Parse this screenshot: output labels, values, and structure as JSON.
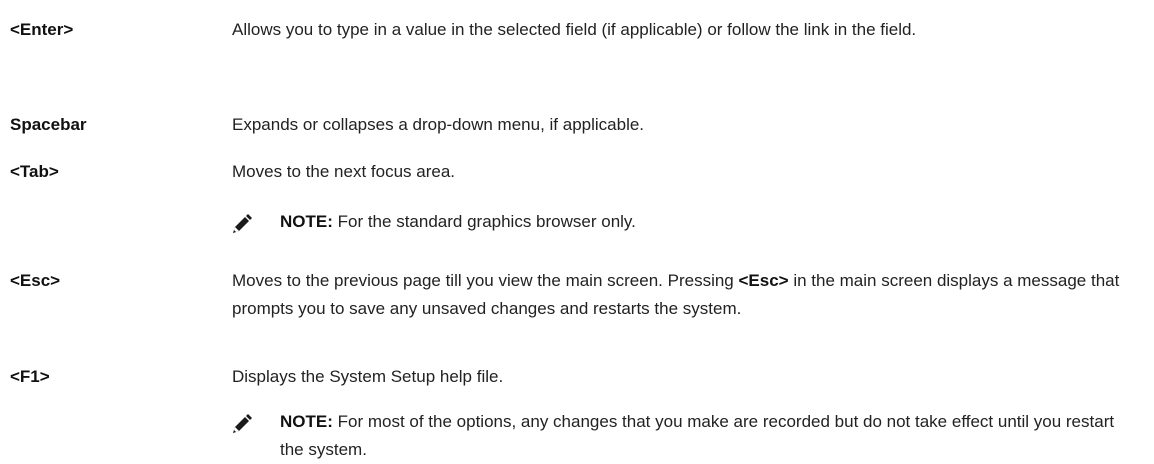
{
  "rows": [
    {
      "key": "<Enter>",
      "description": "Allows you to type in a value in the selected field (if applicable) or follow the link in the field."
    },
    {
      "key": "Spacebar",
      "description": "Expands or collapses a drop-down menu, if applicable."
    },
    {
      "key": "<Tab>",
      "description": "Moves to the next focus area.",
      "note": {
        "label": "NOTE:",
        "text": " For the standard graphics browser only."
      }
    },
    {
      "key": "<Esc>",
      "description_pre": "Moves to the previous page till you view the main screen. Pressing ",
      "description_key": "<Esc>",
      "description_post": " in the main screen displays a message that prompts you to save any unsaved changes and restarts the system."
    },
    {
      "key": "<F1>",
      "description": "Displays the System Setup help file.",
      "note": {
        "label": "NOTE:",
        "text": " For most of the options, any changes that you make are recorded but do not take effect until you restart the system."
      }
    }
  ],
  "icons": {
    "note": "pencil-note-icon"
  }
}
